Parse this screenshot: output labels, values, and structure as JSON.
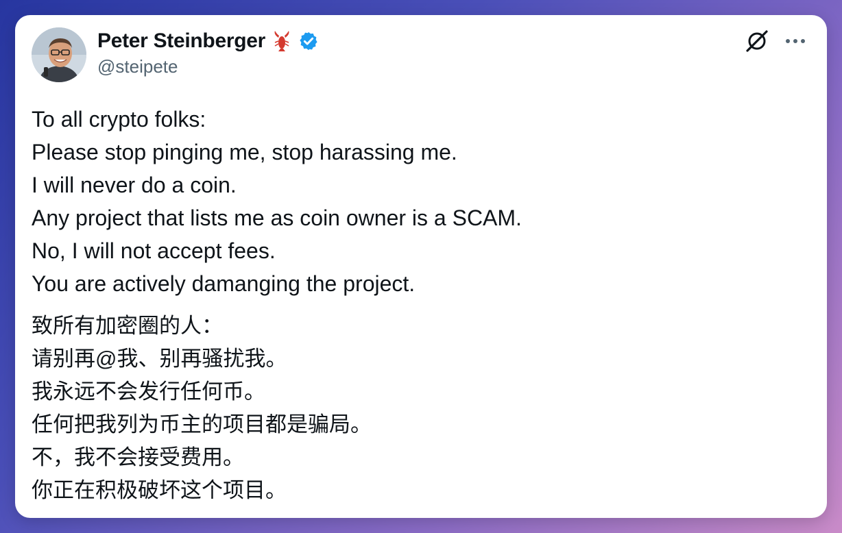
{
  "tweet": {
    "author": {
      "display_name": "Peter Steinberger",
      "emoji": "🦞",
      "handle": "@steipete",
      "verified": true,
      "avatar_icon": "profile-photo"
    },
    "header_icons": [
      "x-logo-icon",
      "more-options-icon"
    ],
    "english_lines": [
      "To all crypto folks:",
      "Please stop pinging me, stop harassing me.",
      "I will never do a coin.",
      "Any project that lists me as coin owner is a SCAM.",
      "No, I will not accept fees.",
      "You are actively damanging the project."
    ],
    "chinese_lines": [
      "致所有加密圈的人：",
      "请别再@我、别再骚扰我。",
      "我永远不会发行任何币。",
      "任何把我列为币主的项目都是骗局。",
      "不，我不会接受费用。",
      "你正在积极破坏这个项目。"
    ]
  },
  "colors": {
    "text_primary": "#0f1419",
    "text_secondary": "#536471",
    "verified_blue": "#1d9bf0",
    "card_background": "#ffffff"
  }
}
